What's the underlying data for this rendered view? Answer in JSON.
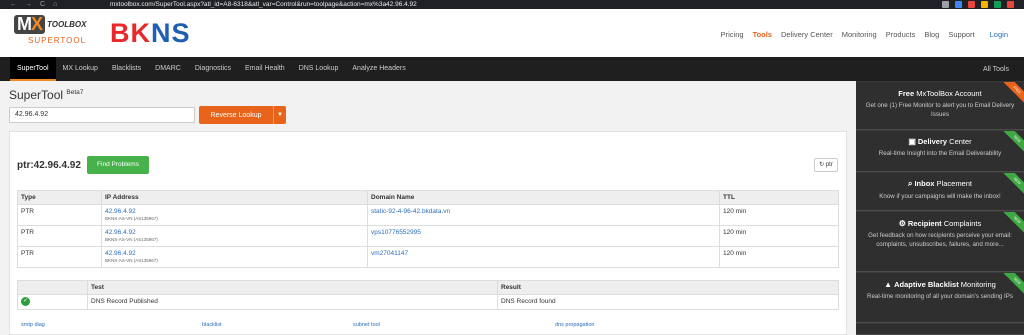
{
  "browser": {
    "url": "mxtoolbox.com/SuperTool.aspx?atl_id=A8-6318&atl_var=Control&run=toolpage&action=mx%3a42.96.4.92",
    "nav_back": "←",
    "nav_forward": "→",
    "nav_reload": "C",
    "nav_home": "⌂",
    "colors": [
      "#4285f4",
      "#e8453c",
      "#f4b400",
      "#0f9d58",
      "#e8453c"
    ]
  },
  "header": {
    "mx_left": "M",
    "mx_x": "X",
    "toolbox": "TOOLBOX",
    "supertool": "SUPERTOOL",
    "bkns": [
      "B",
      "K",
      "N",
      "S"
    ],
    "nav": [
      {
        "label": "Pricing",
        "active": false
      },
      {
        "label": "Tools",
        "active": true
      },
      {
        "label": "Delivery Center",
        "active": false
      },
      {
        "label": "Monitoring",
        "active": false
      },
      {
        "label": "Products",
        "active": false
      },
      {
        "label": "Blog",
        "active": false
      },
      {
        "label": "Support",
        "active": false
      }
    ],
    "login": "Login"
  },
  "darknav": {
    "items": [
      "SuperTool",
      "MX Lookup",
      "Blacklists",
      "DMARC",
      "Diagnostics",
      "Email Health",
      "DNS Lookup",
      "Analyze Headers"
    ],
    "active_index": 0,
    "all_tools": "All Tools"
  },
  "main": {
    "title": "SuperTool",
    "beta": "Beta7",
    "search_value": "42.96.4.92",
    "reverse_label": "Reverse Lookup",
    "ptr_title": "ptr:42.96.4.92",
    "find_problems": "Find Problems",
    "ptr_btn": "ptr",
    "records_table": {
      "headers": [
        "Type",
        "IP Address",
        "Domain Name",
        "TTL"
      ],
      "rows": [
        {
          "type": "PTR",
          "ip": "42.96.4.92",
          "asn": "BKNS-AS-VN (AS135967)",
          "domain": "static-92-4-96-42.bkdata.vn",
          "ttl": "120 min"
        },
        {
          "type": "PTR",
          "ip": "42.96.4.92",
          "asn": "BKNS-AS-VN (AS135967)",
          "domain": "vps10776552995",
          "ttl": "120 min"
        },
        {
          "type": "PTR",
          "ip": "42.96.4.92",
          "asn": "BKNS-AS-VN (AS135967)",
          "domain": "vm27041147",
          "ttl": "120 min"
        }
      ]
    },
    "test_table": {
      "headers": [
        "",
        "Test",
        "Result"
      ],
      "rows": [
        {
          "status": "✓",
          "test": "DNS Record Published",
          "result": "DNS Record found"
        }
      ]
    },
    "foot_links": [
      "smtp diag",
      "blacklist",
      "subnet tool",
      "dns propagation"
    ]
  },
  "sidebar": {
    "boxes": [
      {
        "head_bold": "Free",
        "head_light": " MxToolBox Account",
        "desc": "Get one (1) Free Monitor to alert you to Email Delivery Issues",
        "ribbon": "FREE",
        "ribbon_color": "#e8641b"
      },
      {
        "head_bold": "Delivery",
        "head_light": " Center",
        "desc": "Real-time Insight into the Email Deliverability",
        "ribbon": "NEW",
        "ribbon_color": "#3fa844",
        "icon": "delivery-icon"
      },
      {
        "head_bold": "Inbox",
        "head_light": " Placement",
        "desc": "Know if your campaigns will make the inbox!",
        "ribbon": "NEW",
        "ribbon_color": "#3fa844",
        "icon": "search-icon"
      },
      {
        "head_bold": "Recipient",
        "head_light": " Complaints",
        "desc": "Get feedback on how recipients perceive your email: complaints, unsubscribes, failures, and more...",
        "ribbon": "NEW",
        "ribbon_color": "#3fa844",
        "icon": "gear-icon"
      },
      {
        "head_bold": "Adaptive Blacklist",
        "head_light": " Monitoring",
        "desc": "Real-time monitoring of all your domain's sending IPs",
        "ribbon": "NEW",
        "ribbon_color": "#3fa844",
        "icon": "warning-icon"
      }
    ]
  }
}
